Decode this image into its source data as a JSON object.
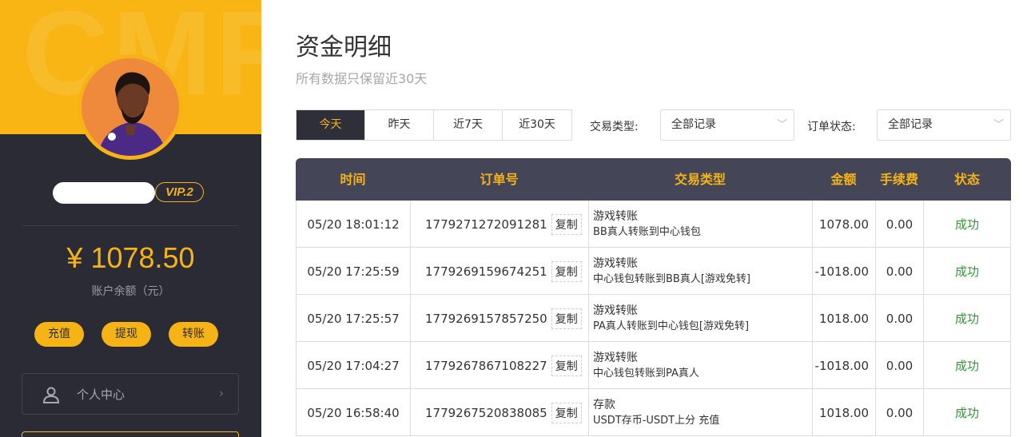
{
  "sidebar": {
    "watermark": "CMF",
    "vip_badge": "VIP.2",
    "balance": "¥ 1078.50",
    "balance_label": "账户余额（元）",
    "actions": [
      {
        "label": "充值"
      },
      {
        "label": "提现"
      },
      {
        "label": "转账"
      }
    ],
    "menu": [
      {
        "label": "个人中心",
        "icon": "user-icon"
      }
    ],
    "accent": "#f5b316"
  },
  "main": {
    "title": "资金明细",
    "subtitle": "所有数据只保留近30天",
    "tabs": [
      {
        "label": "今天",
        "active": true
      },
      {
        "label": "昨天"
      },
      {
        "label": "近7天"
      },
      {
        "label": "近30天"
      }
    ],
    "filters": {
      "type_label": "交易类型:",
      "type_value": "全部记录",
      "status_label": "订单状态:",
      "status_value": "全部记录"
    },
    "table": {
      "headers": [
        "时间",
        "订单号",
        "交易类型",
        "金额",
        "手续费",
        "状态"
      ],
      "copy_label": "复制",
      "rows": [
        {
          "time": "05/20 18:01:12",
          "order": "1779271272091281",
          "type": "游戏转账",
          "detail": "BB真人转账到中心钱包",
          "amount": "1078.00",
          "fee": "0.00",
          "status": "成功"
        },
        {
          "time": "05/20 17:25:59",
          "order": "1779269159674251",
          "type": "游戏转账",
          "detail": "中心钱包转账到BB真人[游戏免转]",
          "amount": "-1018.00",
          "fee": "0.00",
          "status": "成功"
        },
        {
          "time": "05/20 17:25:57",
          "order": "1779269157857250",
          "type": "游戏转账",
          "detail": "PA真人转账到中心钱包[游戏免转]",
          "amount": "1018.00",
          "fee": "0.00",
          "status": "成功"
        },
        {
          "time": "05/20 17:04:27",
          "order": "1779267867108227",
          "type": "游戏转账",
          "detail": "中心钱包转账到PA真人",
          "amount": "-1018.00",
          "fee": "0.00",
          "status": "成功"
        },
        {
          "time": "05/20 16:58:40",
          "order": "1779267520838085",
          "type": "存款",
          "detail": "USDT存币-USDT上分 充值",
          "amount": "1018.00",
          "fee": "0.00",
          "status": "成功"
        }
      ]
    }
  }
}
